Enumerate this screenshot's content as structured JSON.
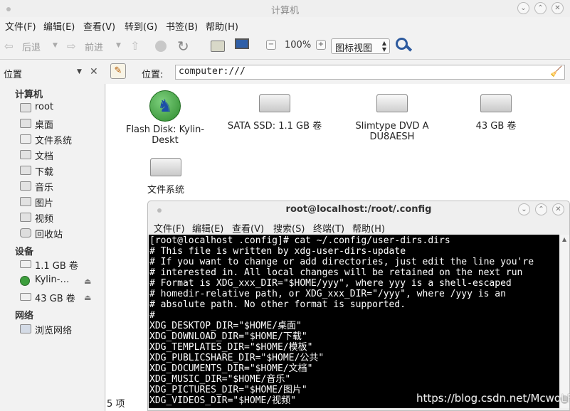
{
  "window": {
    "title": "计算机"
  },
  "menu": [
    "文件(F)",
    "编辑(E)",
    "查看(V)",
    "转到(G)",
    "书签(B)",
    "帮助(H)"
  ],
  "toolbar": {
    "back": "后退",
    "forward": "前进",
    "zoom": "100%",
    "view_mode": "图标视图"
  },
  "location": {
    "panel_title": "位置",
    "label": "位置:",
    "value": "computer:///"
  },
  "sidebar": {
    "computer_header": "计算机",
    "computer_items": [
      "root",
      "桌面",
      "文件系统",
      "文档",
      "下载",
      "音乐",
      "图片",
      "视频",
      "回收站"
    ],
    "devices_header": "设备",
    "device_items": [
      "1.1 GB 卷",
      "Kylin-…",
      "43 GB 卷"
    ],
    "network_header": "网络",
    "network_items": [
      "浏览网络"
    ]
  },
  "devices": [
    {
      "label": "Flash Disk: Kylin-Deskt",
      "icon": "kylin-disc-icon"
    },
    {
      "label": "SATA SSD: 1.1 GB 卷",
      "icon": "hard-drive-icon"
    },
    {
      "label": "Slimtype DVD A DU8AESH",
      "icon": "optical-drive-icon"
    },
    {
      "label": "43 GB 卷",
      "icon": "hard-drive-icon"
    },
    {
      "label": "文件系统",
      "icon": "hard-drive-icon"
    }
  ],
  "status": {
    "count": "5 项"
  },
  "terminal": {
    "title": "root@localhost:/root/.config",
    "menu": [
      "文件(F)",
      "编辑(E)",
      "查看(V)",
      "搜索(S)",
      "终端(T)",
      "帮助(H)"
    ],
    "lines": [
      "[root@localhost .config]# cat ~/.config/user-dirs.dirs",
      "# This file is written by xdg-user-dirs-update",
      "# If you want to change or add directories, just edit the line you're",
      "# interested in. All local changes will be retained on the next run",
      "# Format is XDG_xxx_DIR=\"$HOME/yyy\", where yyy is a shell-escaped",
      "# homedir-relative path, or XDG_xxx_DIR=\"/yyy\", where /yyy is an",
      "# absolute path. No other format is supported.",
      "#",
      "XDG_DESKTOP_DIR=\"$HOME/桌面\"",
      "XDG_DOWNLOAD_DIR=\"$HOME/下载\"",
      "XDG_TEMPLATES_DIR=\"$HOME/模板\"",
      "XDG_PUBLICSHARE_DIR=\"$HOME/公共\"",
      "XDG_DOCUMENTS_DIR=\"$HOME/文档\"",
      "XDG_MUSIC_DIR=\"$HOME/音乐\"",
      "XDG_PICTURES_DIR=\"$HOME/图片\"",
      "XDG_VIDEOS_DIR=\"$HOME/视频\""
    ]
  },
  "watermark": "https://blog.csdn.net/McwoLF"
}
